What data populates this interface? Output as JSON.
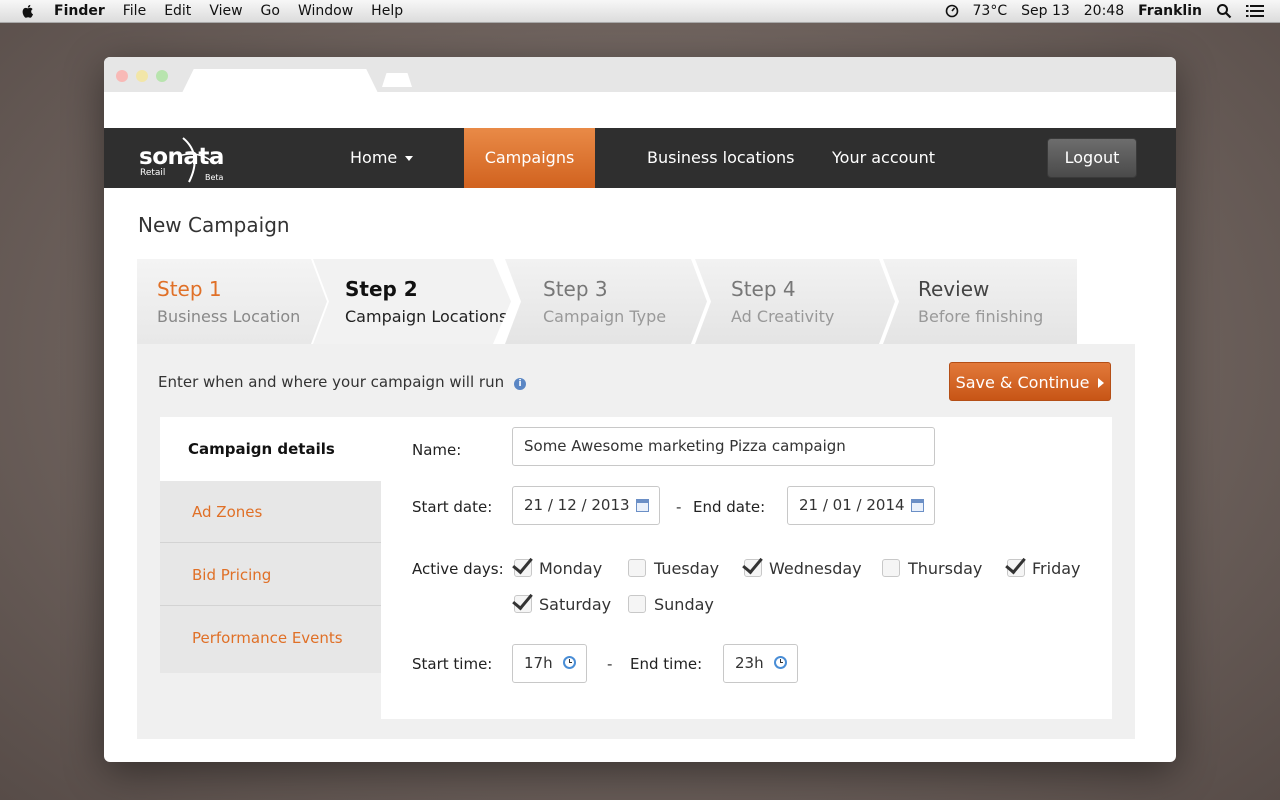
{
  "menubar": {
    "app": "Finder",
    "items": [
      "File",
      "Edit",
      "View",
      "Go",
      "Window",
      "Help"
    ],
    "temperature": "73°C",
    "date": "Sep 13",
    "time": "20:48",
    "user": "Franklin"
  },
  "nav": {
    "brand": "sonata",
    "brand_sub": "Retail",
    "brand_beta": "Beta",
    "home": "Home",
    "campaigns": "Campaigns",
    "locations": "Business locations",
    "account": "Your account",
    "logout": "Logout"
  },
  "page": {
    "title": "New Campaign",
    "intro": "Enter when and where your campaign will run",
    "save_label": "Save & Continue"
  },
  "steps": [
    {
      "num": "Step 1",
      "label": "Business Location"
    },
    {
      "num": "Step 2",
      "label": "Campaign Locations"
    },
    {
      "num": "Step 3",
      "label": "Campaign Type"
    },
    {
      "num": "Step 4",
      "label": "Ad Creativity"
    },
    {
      "num": "Review",
      "label": "Before finishing"
    }
  ],
  "sidebar": {
    "items": [
      "Campaign details",
      "Ad Zones",
      "Bid Pricing",
      "Performance Events"
    ]
  },
  "form": {
    "name_label": "Name:",
    "name_value": "Some Awesome marketing Pizza campaign",
    "start_date_label": "Start date:",
    "start_date": "21 / 12 / 2013",
    "end_date_label": "End date:",
    "end_date": "21 / 01 / 2014",
    "active_days_label": "Active days:",
    "days": [
      {
        "label": "Monday",
        "checked": true
      },
      {
        "label": "Tuesday",
        "checked": false
      },
      {
        "label": "Wednesday",
        "checked": true
      },
      {
        "label": "Thursday",
        "checked": false
      },
      {
        "label": "Friday",
        "checked": true
      },
      {
        "label": "Saturday",
        "checked": true
      },
      {
        "label": "Sunday",
        "checked": false
      }
    ],
    "start_time_label": "Start time:",
    "start_time": "17h",
    "end_time_label": "End time:",
    "end_time": "23h",
    "separator": "-"
  },
  "colors": {
    "accent": "#e07027",
    "nav_bg": "#2f2f2f",
    "panel_bg": "#f0f0f0"
  }
}
